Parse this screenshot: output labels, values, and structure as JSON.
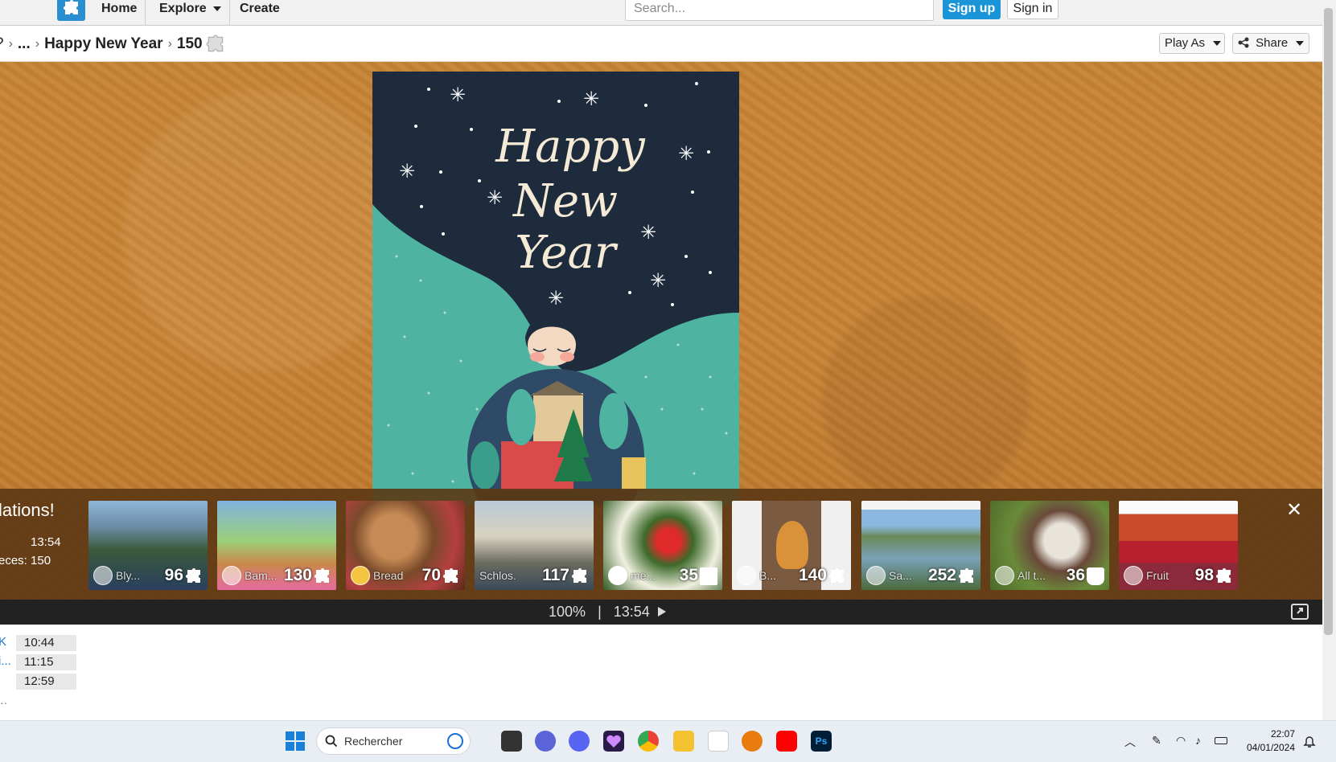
{
  "topnav": {
    "home": "Home",
    "explore": "Explore",
    "create": "Create",
    "search_placeholder": "Search...",
    "signup": "Sign up",
    "signin": "Sign in"
  },
  "breadcrumb": {
    "prefix": "?",
    "ellipsis": "...",
    "title": "Happy New Year",
    "pieces": "150"
  },
  "actions": {
    "play_as": "Play As",
    "share": "Share"
  },
  "overlay": {
    "title": "lations!",
    "time": "13:54",
    "pieces": "eces: 150",
    "thumbs": [
      {
        "name": "Bly...",
        "count": "96"
      },
      {
        "name": "Bam...",
        "count": "130"
      },
      {
        "name": "Bread",
        "count": "70"
      },
      {
        "name": "Schlos...",
        "count": "117"
      },
      {
        "name": "me...",
        "count": "35"
      },
      {
        "name": "B...",
        "count": "140"
      },
      {
        "name": "Sa...",
        "count": "252"
      },
      {
        "name": "All t...",
        "count": "36"
      },
      {
        "name": "Fruit",
        "count": "98"
      }
    ]
  },
  "status": {
    "zoom": "100%",
    "divider": "|",
    "time": "13:54"
  },
  "times": [
    {
      "prefix": "K",
      "value": "10:44"
    },
    {
      "prefix": "i...",
      "value": "11:15"
    },
    {
      "prefix": "",
      "value": "12:59"
    }
  ],
  "card": {
    "line1": "Happy",
    "line2": "New",
    "line3": "Year"
  },
  "taskbar": {
    "search": "Rechercher",
    "time": "22:07",
    "date": "04/01/2024"
  },
  "colors": {
    "accent": "#1a96d8",
    "board": "#c98335",
    "overlay": "#5c3714"
  }
}
